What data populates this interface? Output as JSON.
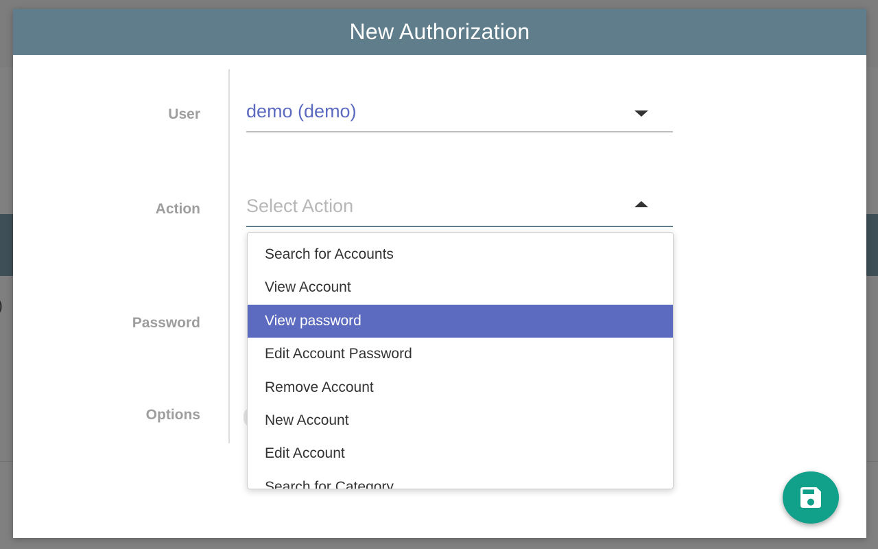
{
  "background": {
    "partial_text": ")"
  },
  "modal": {
    "title": "New Authorization",
    "header_color": "#607d8b",
    "accent_color": "#5c6bc0",
    "save_button_color": "#11a08a"
  },
  "form": {
    "user": {
      "label": "User",
      "selected_value": "demo (demo)"
    },
    "action": {
      "label": "Action",
      "placeholder": "Select Action",
      "expanded": true
    },
    "password": {
      "label": "Password"
    },
    "options": {
      "label": "Options"
    }
  },
  "action_dropdown": {
    "items": [
      "Search for Accounts",
      "View Account",
      "View password",
      "Edit Account Password",
      "Remove Account",
      "New Account",
      "Edit Account",
      "Search for Category"
    ],
    "highlighted_item": "View password"
  },
  "icons": {
    "user_caret": "caret-down-icon",
    "action_caret": "caret-up-icon",
    "save": "floppy-disk-icon"
  }
}
